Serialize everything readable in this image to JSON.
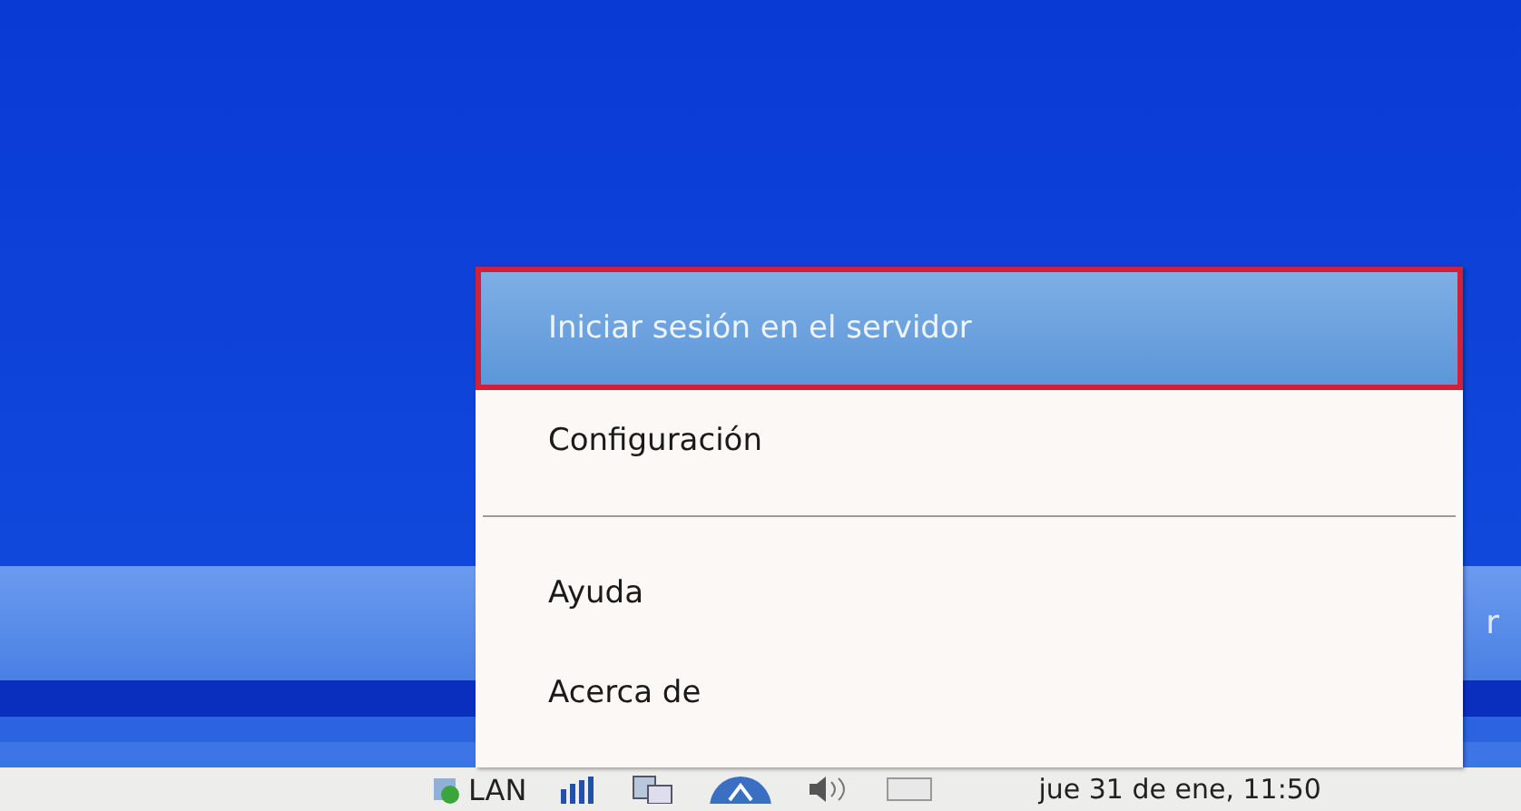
{
  "desktop_panel": {
    "text": "r"
  },
  "taskbar": {
    "tray_label": "LAN",
    "clock": "jue 31 de ene, 11:50"
  },
  "menu": {
    "items": [
      {
        "kind": "item",
        "label": "Iniciar sesión en el servidor",
        "selected": true
      },
      {
        "kind": "item",
        "label": "Configuración",
        "selected": false
      },
      {
        "kind": "separator"
      },
      {
        "kind": "item",
        "label": "Ayuda",
        "selected": false
      },
      {
        "kind": "item",
        "label": "Acerca de",
        "selected": false
      }
    ]
  }
}
